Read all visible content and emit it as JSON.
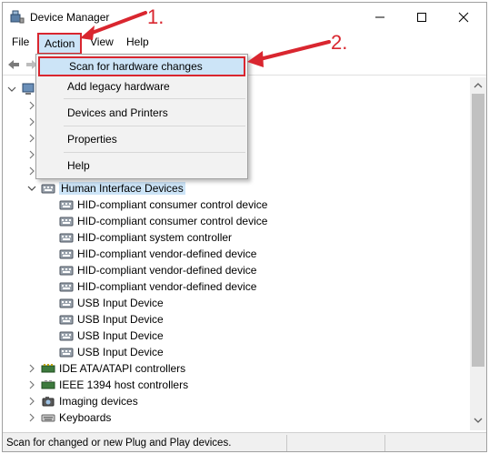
{
  "window": {
    "title": "Device Manager"
  },
  "menu": {
    "file": "File",
    "action": "Action",
    "view": "View",
    "help": "Help"
  },
  "dropdown": {
    "scan": "Scan for hardware changes",
    "legacy": "Add legacy hardware",
    "devices_printers": "Devices and Printers",
    "properties": "Properties",
    "help": "Help"
  },
  "tree": {
    "hid_group": "Human Interface Devices",
    "hid_children": [
      "HID-compliant consumer control device",
      "HID-compliant consumer control device",
      "HID-compliant system controller",
      "HID-compliant vendor-defined device",
      "HID-compliant vendor-defined device",
      "HID-compliant vendor-defined device",
      "USB Input Device",
      "USB Input Device",
      "USB Input Device",
      "USB Input Device"
    ],
    "ide": "IDE ATA/ATAPI controllers",
    "ieee": "IEEE 1394 host controllers",
    "imaging": "Imaging devices",
    "keyboards": "Keyboards"
  },
  "status": {
    "text": "Scan for changed or new Plug and Play devices."
  },
  "annotations": {
    "step1": "1.",
    "step2": "2."
  },
  "colors": {
    "accent_red": "#d9262f",
    "highlight": "#cce4f7"
  },
  "icons": {
    "app": "device-manager-icon",
    "hid": "hid-device-icon",
    "ide": "ide-controller-icon",
    "ieee": "ieee1394-icon",
    "imaging": "camera-icon",
    "keyboard": "keyboard-icon"
  }
}
